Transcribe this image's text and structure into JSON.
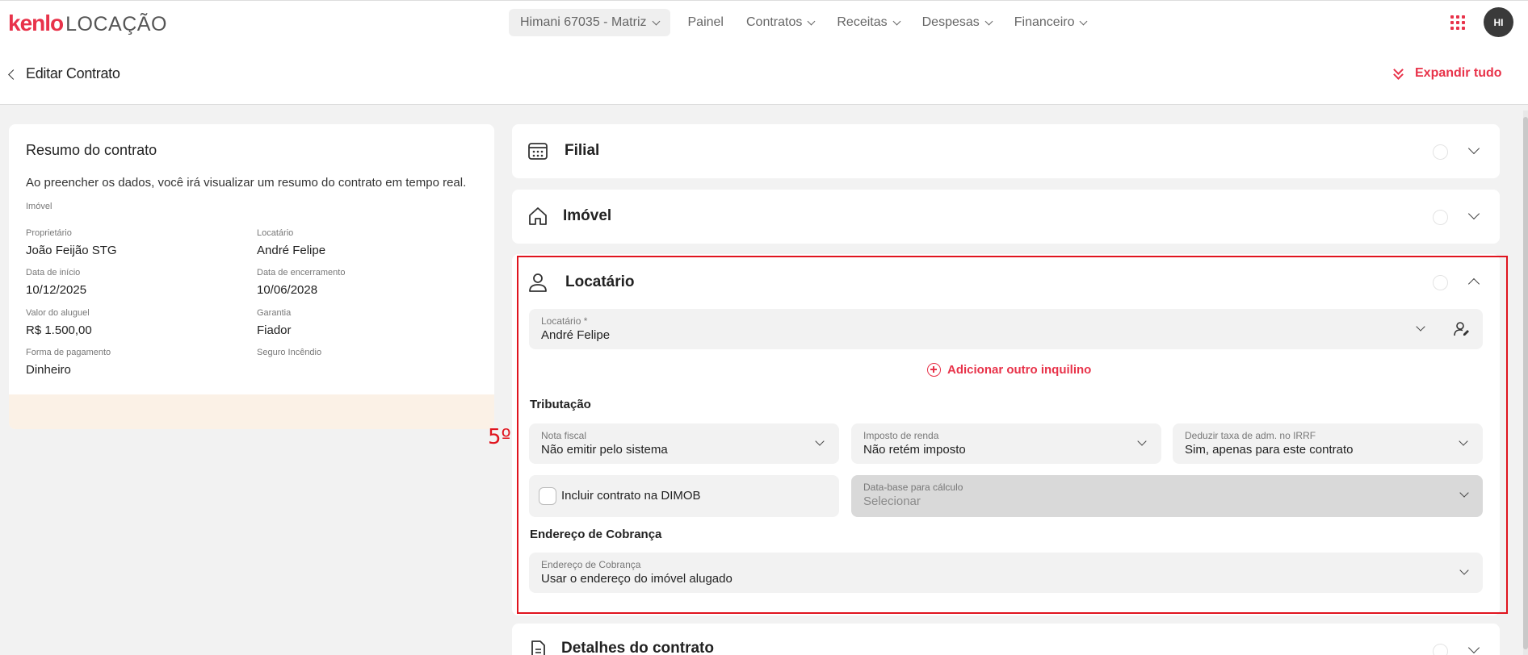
{
  "brand": {
    "logo_name": "kenlo",
    "logo_product": "LOCAÇÃO",
    "accent": "#e8334a"
  },
  "nav": {
    "branch": "Himani 67035 - Matriz",
    "items": [
      "Painel",
      "Contratos",
      "Receitas",
      "Despesas",
      "Financeiro"
    ]
  },
  "user": {
    "initials": "HI"
  },
  "header": {
    "title": "Editar Contrato",
    "expand_all": "Expandir tudo"
  },
  "summary": {
    "title": "Resumo do contrato",
    "description": "Ao preencher os dados, você irá visualizar um resumo do contrato em tempo real.",
    "imovel_label": "Imóvel",
    "fields": [
      {
        "label": "Proprietário",
        "value": "João Feijão STG"
      },
      {
        "label": "Locatário",
        "value": "André Felipe"
      },
      {
        "label": "Data de início",
        "value": "10/12/2025"
      },
      {
        "label": "Data de encerramento",
        "value": "10/06/2028"
      },
      {
        "label": "Valor do aluguel",
        "value": "R$ 1.500,00"
      },
      {
        "label": "Garantia",
        "value": "Fiador"
      },
      {
        "label": "Forma de pagamento",
        "value": "Dinheiro"
      },
      {
        "label": "Seguro Incêndio",
        "value": ""
      }
    ]
  },
  "sections": {
    "filial": "Filial",
    "imovel": "Imóvel",
    "locatario": "Locatário",
    "detalhes": "Detalhes do contrato"
  },
  "locatario_form": {
    "tenant_label": "Locatário *",
    "tenant_value": "André Felipe",
    "add_tenant": "Adicionar outro inquilino",
    "tributacao": "Tributação",
    "nota_fiscal_label": "Nota fiscal",
    "nota_fiscal_value": "Não emitir pelo sistema",
    "imposto_label": "Imposto de renda",
    "imposto_value": "Não retém imposto",
    "deduzir_label": "Deduzir taxa de adm. no IRRF",
    "deduzir_value": "Sim, apenas para este contrato",
    "dimob_label": "Incluir contrato na DIMOB",
    "data_base_label": "Data-base para cálculo",
    "data_base_value": "Selecionar",
    "endereco_heading": "Endereço de Cobrança",
    "endereco_label": "Endereço de Cobrança",
    "endereco_value": "Usar o endereço do imóvel alugado"
  },
  "annotation": "5º"
}
